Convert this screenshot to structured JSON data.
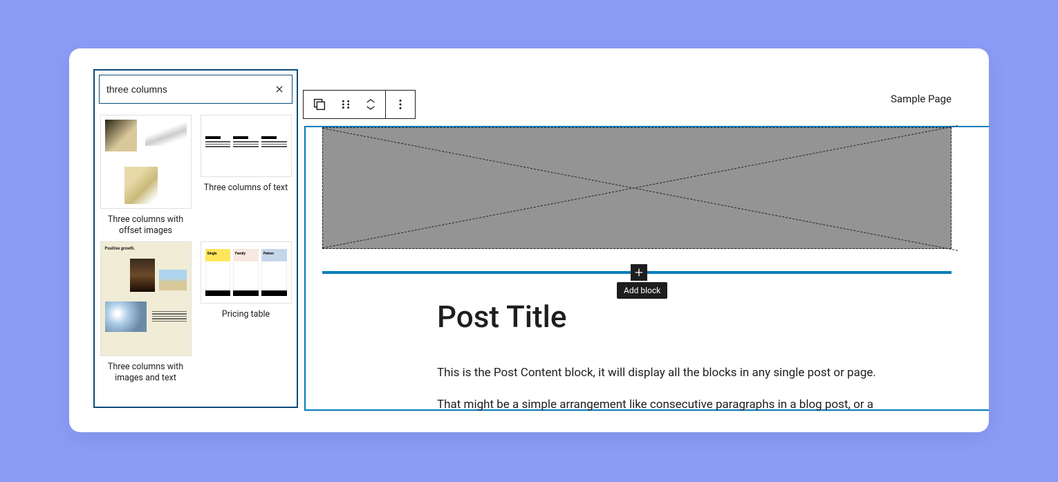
{
  "inserter": {
    "search_value": "three columns",
    "patterns": [
      {
        "label": "Three columns with offset images"
      },
      {
        "label": "Three columns of text"
      },
      {
        "label": "Three columns with images and text",
        "thumb_heading": "Positive growth."
      },
      {
        "label": "Pricing table",
        "cards": [
          "Single",
          "Family",
          "Patron"
        ]
      }
    ]
  },
  "header": {
    "sample_page": "Sample Page"
  },
  "editor": {
    "post_title": "Post Title",
    "paragraph_1": "This is the Post Content block, it will display all the blocks in any single post or page.",
    "paragraph_2": "That might be a simple arrangement like consecutive paragraphs in a blog post, or a",
    "add_block_tooltip": "Add block"
  }
}
